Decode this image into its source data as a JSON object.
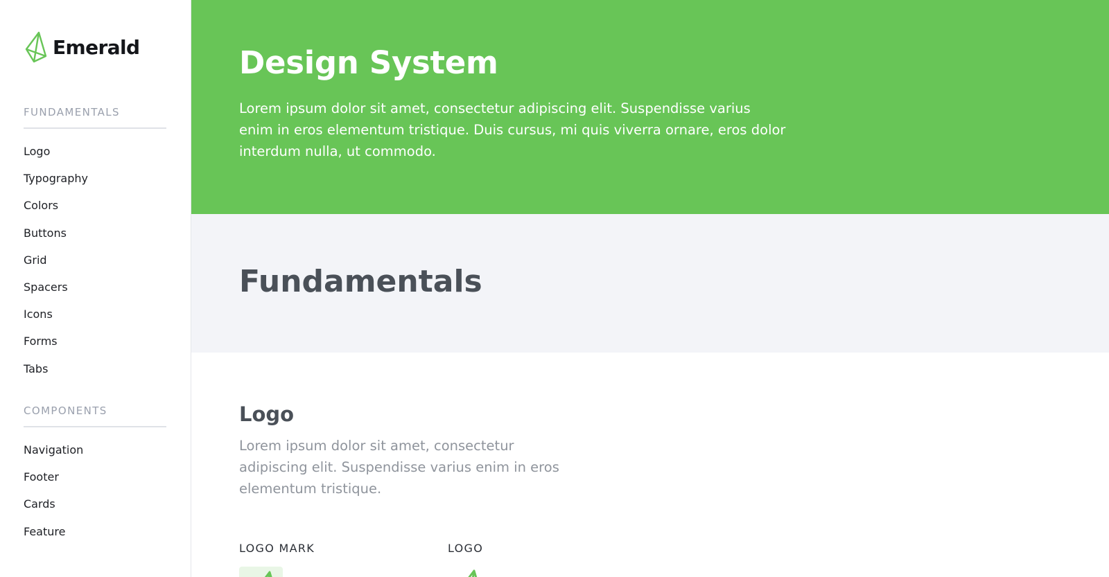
{
  "brand": {
    "name": "Emerald",
    "icon": "emerald-gem-icon",
    "accent_color": "#68c557"
  },
  "sidebar": {
    "sections": [
      {
        "heading": "FUNDAMENTALS",
        "items": [
          "Logo",
          "Typography",
          "Colors",
          "Buttons",
          "Grid",
          "Spacers",
          "Icons",
          "Forms",
          "Tabs"
        ]
      },
      {
        "heading": "COMPONENTS",
        "items": [
          "Navigation",
          "Footer",
          "Cards",
          "Feature"
        ]
      }
    ]
  },
  "hero": {
    "title": "Design System",
    "text": "Lorem ipsum dolor sit amet, consectetur adipiscing elit. Suspendisse varius enim in eros elementum tristique. Duis cursus, mi quis viverra ornare, eros dolor interdum nulla, ut commodo."
  },
  "fundamentals": {
    "title": "Fundamentals"
  },
  "logo_section": {
    "heading": "Logo",
    "description": "Lorem ipsum dolor sit amet, consectetur adipiscing elit. Suspendisse varius enim in eros elementum tristique.",
    "mark_label": "LOGO MARK",
    "logo_label": "LOGO"
  }
}
